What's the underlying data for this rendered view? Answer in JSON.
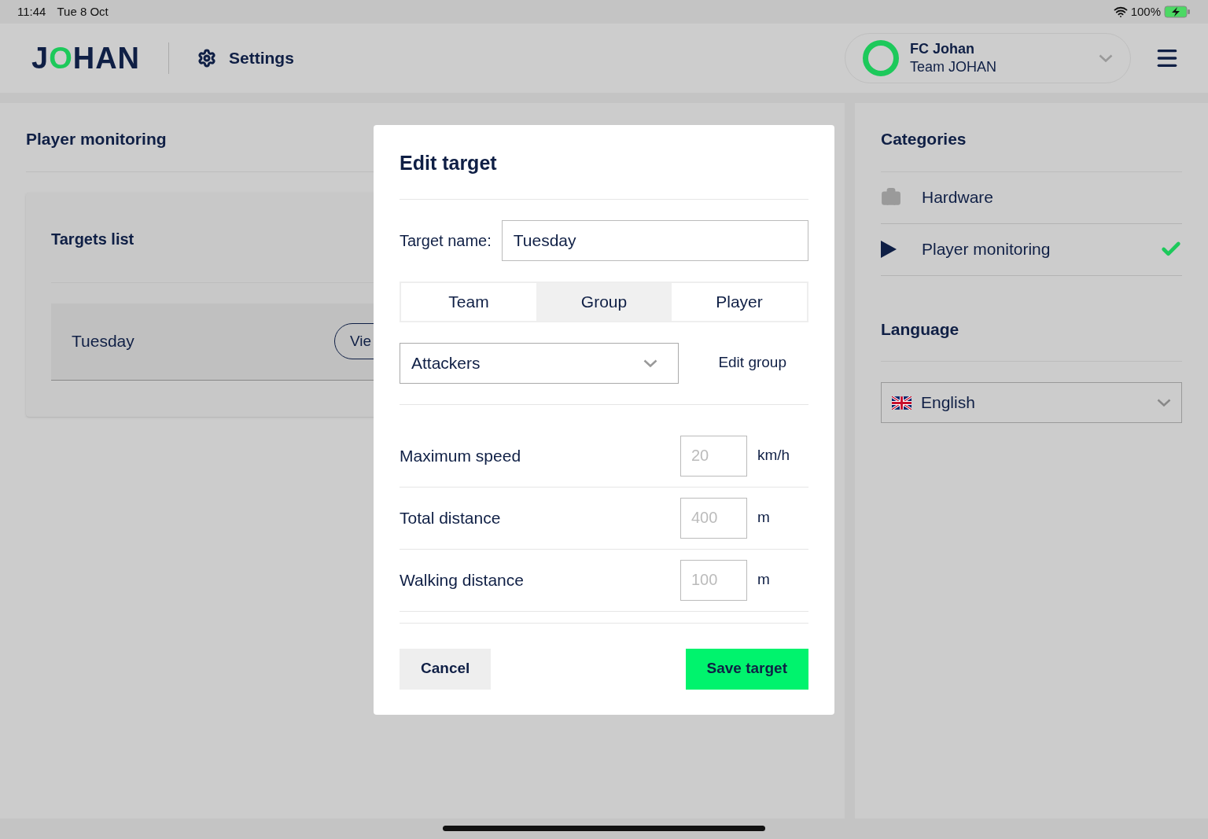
{
  "status_bar": {
    "time": "11:44",
    "date": "Tue 8 Oct",
    "battery": "100%"
  },
  "header": {
    "logo_parts": [
      "J",
      "O",
      "HAN"
    ],
    "section": "Settings",
    "club": {
      "name": "FC Johan",
      "team": "Team JOHAN"
    }
  },
  "main": {
    "title": "Player monitoring",
    "card": {
      "title": "Targets list",
      "rows": [
        {
          "name": "Tuesday",
          "action": "Vie"
        }
      ]
    }
  },
  "sidebar": {
    "categories_title": "Categories",
    "categories": [
      {
        "label": "Hardware",
        "kind": "hardware",
        "selected": false
      },
      {
        "label": "Player monitoring",
        "kind": "play",
        "selected": true
      }
    ],
    "language_title": "Language",
    "language": "English"
  },
  "dialog": {
    "title": "Edit target",
    "name_label": "Target name:",
    "name_value": "Tuesday",
    "tabs": [
      {
        "label": "Team",
        "selected": false
      },
      {
        "label": "Group",
        "selected": true
      },
      {
        "label": "Player",
        "selected": false
      }
    ],
    "group_value": "Attackers",
    "edit_group": "Edit group",
    "fields": [
      {
        "label": "Maximum speed",
        "placeholder": "20",
        "unit": "km/h"
      },
      {
        "label": "Total distance",
        "placeholder": "400",
        "unit": "m"
      },
      {
        "label": "Walking distance",
        "placeholder": "100",
        "unit": "m"
      }
    ],
    "cancel": "Cancel",
    "save": "Save target"
  }
}
